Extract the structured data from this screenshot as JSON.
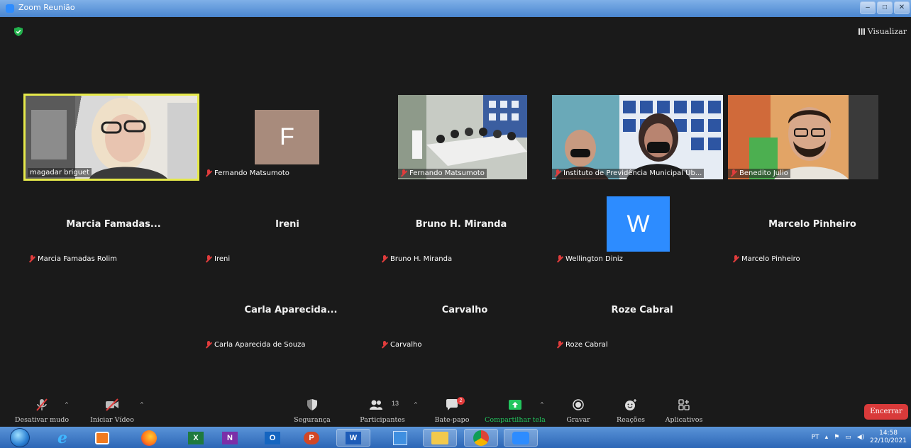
{
  "window": {
    "title": "Zoom Reunião"
  },
  "top": {
    "view_label": "Visualizar"
  },
  "video_tiles": [
    {
      "name": "magadar briguet"
    },
    {
      "name": "Fernando Matsumoto",
      "initial": "F"
    },
    {
      "name": "Fernando Matsumoto"
    },
    {
      "name": "Instituto de Previdência Municipal Ub..."
    },
    {
      "name": "Benedito Julio"
    }
  ],
  "name_tiles": [
    {
      "display": "Marcia  Famadas...",
      "name": "Marcia Famadas Rolim"
    },
    {
      "display": "Ireni",
      "name": "Ireni"
    },
    {
      "display": "Bruno H. Miranda",
      "name": "Bruno H. Miranda"
    },
    {
      "display": "",
      "name": "Wellington Diniz",
      "initial": "W"
    },
    {
      "display": "Marcelo Pinheiro",
      "name": "Marcelo Pinheiro"
    },
    {
      "display": "Carla Aparecida...",
      "name": "Carla Aparecida de Souza"
    },
    {
      "display": "Carvalho",
      "name": "Carvalho"
    },
    {
      "display": "Roze Cabral",
      "name": "Roze Cabral"
    }
  ],
  "toolbar": {
    "mute_label": "Desativar mudo",
    "video_label": "Iniciar Vídeo",
    "security_label": "Segurança",
    "participants_label": "Participantes",
    "participants_count": "13",
    "chat_label": "Bate-papo",
    "chat_badge": "2",
    "share_label": "Compartilhar tela",
    "record_label": "Gravar",
    "reactions_label": "Reações",
    "apps_label": "Aplicativos",
    "end_label": "Encerrar"
  },
  "taskbar": {
    "language": "PT",
    "time": "14:58",
    "date": "22/10/2021"
  },
  "colors": {
    "accent": "#2d8cff",
    "share_green": "#22c55e",
    "end_red": "#d93a3a",
    "active_speaker": "#e6e94a"
  }
}
